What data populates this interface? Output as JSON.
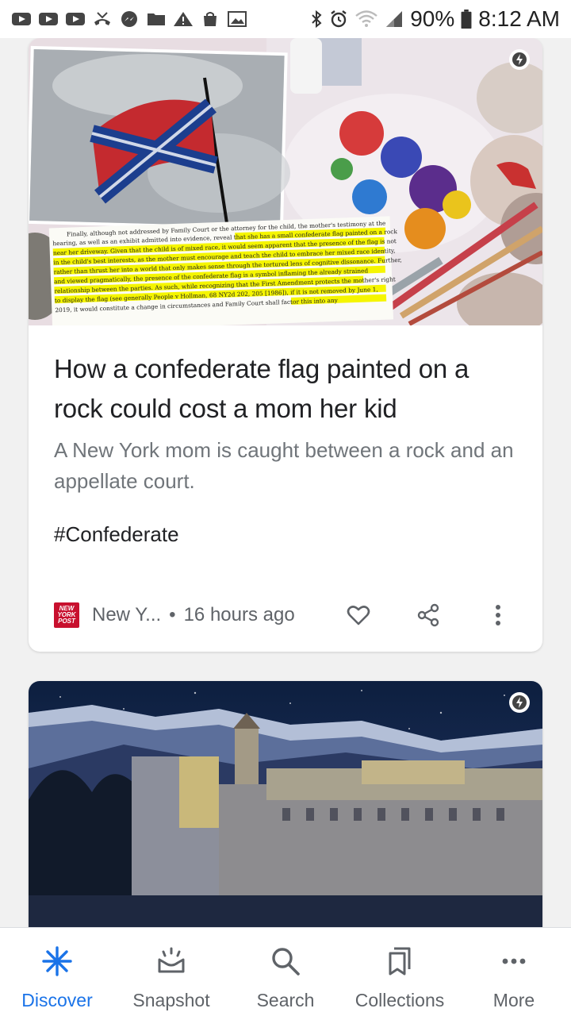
{
  "status_bar": {
    "battery": "90%",
    "time": "8:12 AM",
    "icons": [
      "youtube-icon",
      "youtube-icon",
      "youtube-icon",
      "missed-call-icon",
      "messenger-icon",
      "folder-icon",
      "warning-icon",
      "shopping-bag-icon",
      "gallery-icon",
      "bluetooth-icon",
      "alarm-icon",
      "wifi-icon",
      "signal-icon",
      "battery-icon"
    ]
  },
  "feed": {
    "cards": [
      {
        "headline": "How a confederate flag painted on a rock could cost a mom her kid",
        "subhead": "A New York mom is caught between a rock and an appellate court.",
        "hashtag": "#Confederate",
        "publisher_logo": "NEW YORK POST",
        "publisher": "New Y...",
        "separator": "•",
        "time_ago": "16 hours ago",
        "image_text": {
          "line1": "Finally, although not addressed by Family Court or the attorney for the child, the mother's testimony at the",
          "line2": "hearing, as well as an exhibit admitted into evidence, reveal that she has a small confederate flag painted on a rock",
          "line3": "near her driveway. Given that the child is of mixed race, it would seem apparent that the presence of the flag is not",
          "line4": "in the child's best interests, as the mother must encourage and teach the child to embrace her mixed race identity,",
          "line5": "rather than thrust her into a world that only makes sense through the tortured lens of cognitive dissonance. Further,",
          "line6": "and viewed pragmatically, the presence of the confederate flag is a symbol inflaming the already strained",
          "line7": "relationship between the parties. As such, while recognizing that the First Amendment protects the mother's right",
          "line8": "to display the flag (see generally People v Hollman, 68 NY2d 202, 205 [1986]), if it is not removed by June 1,",
          "line9": "2019, it would constitute a change in circumstances and Family Court shall factor this into any"
        }
      },
      {}
    ]
  },
  "bottom_nav": {
    "items": [
      {
        "label": "Discover",
        "icon": "discover-icon",
        "active": true
      },
      {
        "label": "Snapshot",
        "icon": "snapshot-icon",
        "active": false
      },
      {
        "label": "Search",
        "icon": "search-icon",
        "active": false
      },
      {
        "label": "Collections",
        "icon": "collections-icon",
        "active": false
      },
      {
        "label": "More",
        "icon": "more-horizontal-icon",
        "active": false
      }
    ]
  },
  "colors": {
    "accent": "#1a73e8",
    "text_primary": "#202124",
    "text_secondary": "#5f6368",
    "publisher_red": "#c8102e",
    "highlight_yellow": "#f5f500"
  }
}
